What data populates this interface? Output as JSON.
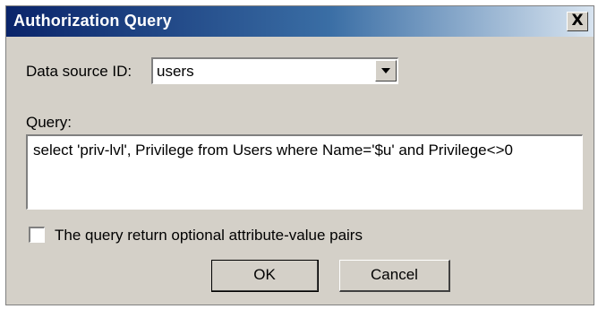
{
  "window": {
    "title": "Authorization Query",
    "close_label": "X"
  },
  "data_source": {
    "label": "Data source ID:",
    "selected_value": "users"
  },
  "query": {
    "label": "Query:",
    "value": "select 'priv-lvl', Privilege from Users where Name='$u' and Privilege<>0"
  },
  "option": {
    "checked": false,
    "label": "The query return optional attribute-value pairs"
  },
  "buttons": {
    "ok_label": "OK",
    "cancel_label": "Cancel"
  },
  "icons": [
    "close-icon",
    "chevron-down-icon"
  ],
  "colors": {
    "title_bar_start": "#0a246a",
    "title_bar_end": "#d8e4f0",
    "dialog_face": "#d4d0c8",
    "field_background": "#ffffff"
  }
}
